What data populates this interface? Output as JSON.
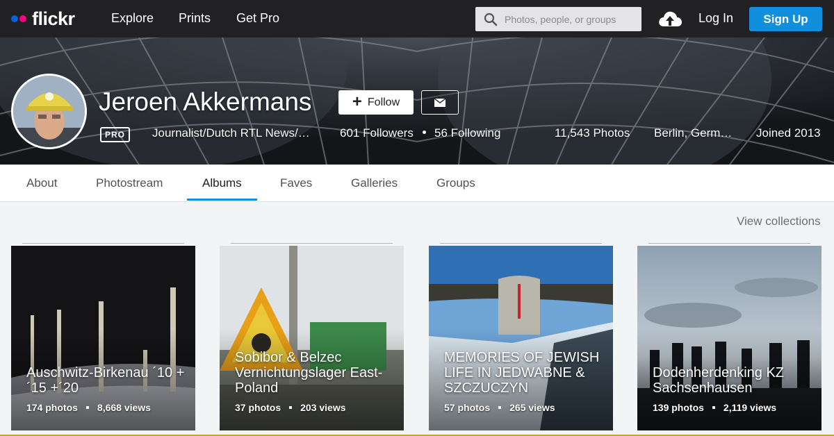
{
  "nav": {
    "logo": "flickr",
    "links": [
      "Explore",
      "Prints",
      "Get Pro"
    ],
    "search_placeholder": "Photos, people, or groups",
    "login": "Log In",
    "signup": "Sign Up",
    "colors": {
      "bar": "#212124",
      "logo_blue": "#0063dc",
      "logo_pink": "#ff0084",
      "signup": "#128fdc"
    }
  },
  "profile": {
    "name": "Jeroen Akkermans",
    "follow_label": "Follow",
    "badge": "PRO",
    "description": "Journalist/Dutch RTL News/…",
    "followers": "601 Followers",
    "following": "56 Following",
    "photos": "11,543 Photos",
    "location": "Berlin, Germ…",
    "joined": "Joined 2013"
  },
  "tabs": [
    {
      "label": "About",
      "active": false
    },
    {
      "label": "Photostream",
      "active": false
    },
    {
      "label": "Albums",
      "active": true
    },
    {
      "label": "Faves",
      "active": false
    },
    {
      "label": "Galleries",
      "active": false
    },
    {
      "label": "Groups",
      "active": false
    }
  ],
  "view_collections": "View collections",
  "albums": [
    {
      "title": "Auschwitz-Birkenau ´10 +´15 +´20",
      "photos": "174 photos",
      "views": "8,668 views"
    },
    {
      "title": "Sobibor & Belzec Vernichtungslager East-Poland",
      "photos": "37 photos",
      "views": "203 views"
    },
    {
      "title": "MEMORIES OF JEWISH LIFE IN JEDWABNE & SZCZUCZYN",
      "photos": "57 photos",
      "views": "265 views"
    },
    {
      "title": "Dodenherdenking KZ Sachsenhausen",
      "photos": "139 photos",
      "views": "2,119 views"
    }
  ]
}
